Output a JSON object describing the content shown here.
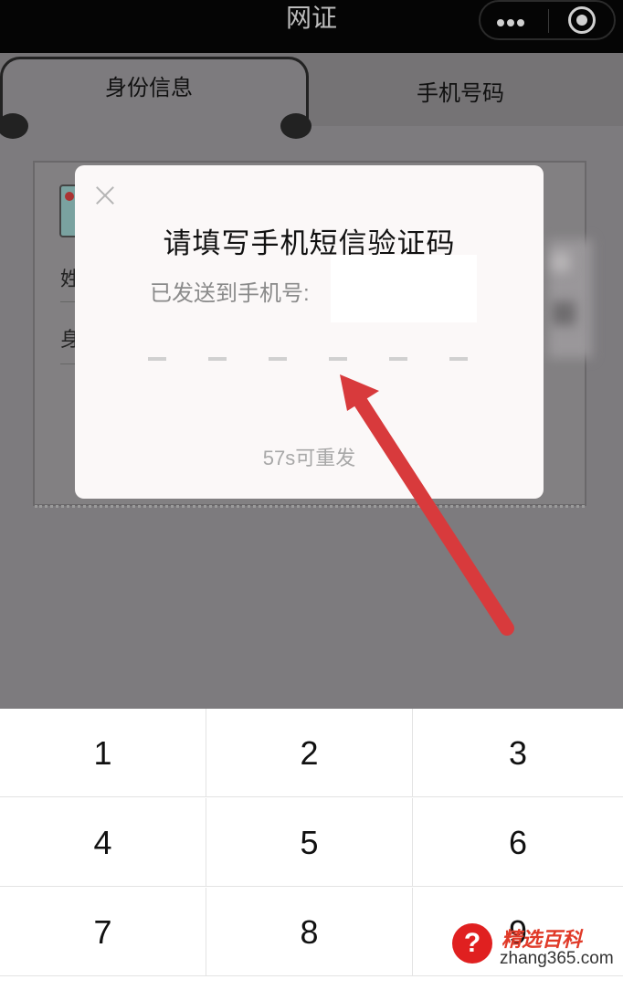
{
  "window": {
    "title": "网证"
  },
  "capsule": {
    "more_icon": "more-dots-icon",
    "close_icon": "target-circle-icon"
  },
  "tabs": [
    {
      "label": "身份信息",
      "active": true
    },
    {
      "label": "手机号码",
      "active": false
    }
  ],
  "card": {
    "fields": [
      "姓",
      "身"
    ]
  },
  "dialog": {
    "title": "请填写手机短信验证码",
    "sent_prefix": "已发送到手机号:",
    "code_length": 6,
    "resend": "57s可重发"
  },
  "keypad": {
    "keys": [
      "1",
      "2",
      "3",
      "4",
      "5",
      "6",
      "7",
      "8",
      "9"
    ]
  },
  "watermark": {
    "brand": "精选百科",
    "site": "zhang365.com",
    "icon": "question-mark-icon"
  },
  "colors": {
    "arrow": "#d83a3c",
    "overlay": "#7d7b7e",
    "dialog": "#fbf8f8"
  }
}
